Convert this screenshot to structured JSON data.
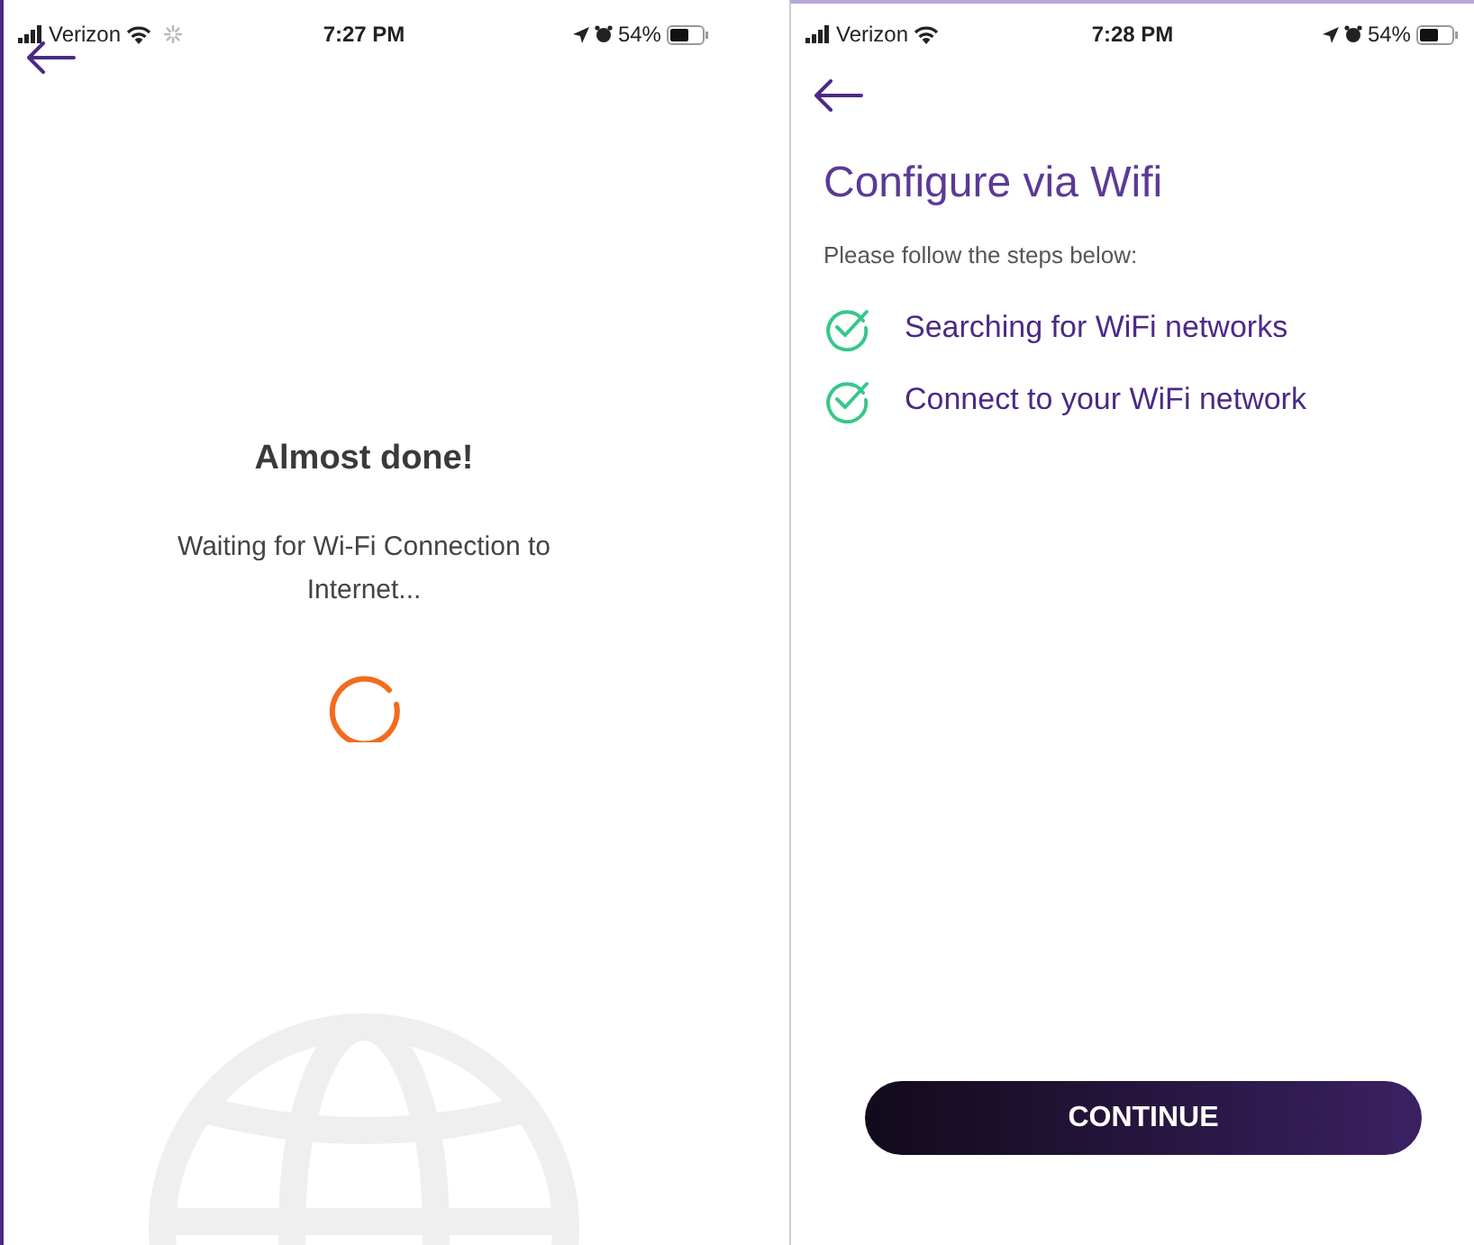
{
  "screens": [
    {
      "kind": "waiting",
      "status_bar": {
        "carrier": "Verizon",
        "activity": true,
        "time": "7:27 PM",
        "battery": "54%"
      },
      "title": "Almost done!",
      "message": "Waiting for Wi-Fi Connection to Internet..."
    },
    {
      "kind": "steps",
      "status_bar": {
        "carrier": "Verizon",
        "activity": false,
        "time": "7:28 PM",
        "battery": "54%"
      },
      "title": "Configure via Wifi",
      "subtitle": "Please follow the steps below:",
      "steps": [
        {
          "label": "Searching for WiFi networks",
          "done": true
        },
        {
          "label": "Connect to your WiFi network",
          "done": true
        }
      ],
      "button": "CONTINUE"
    }
  ]
}
